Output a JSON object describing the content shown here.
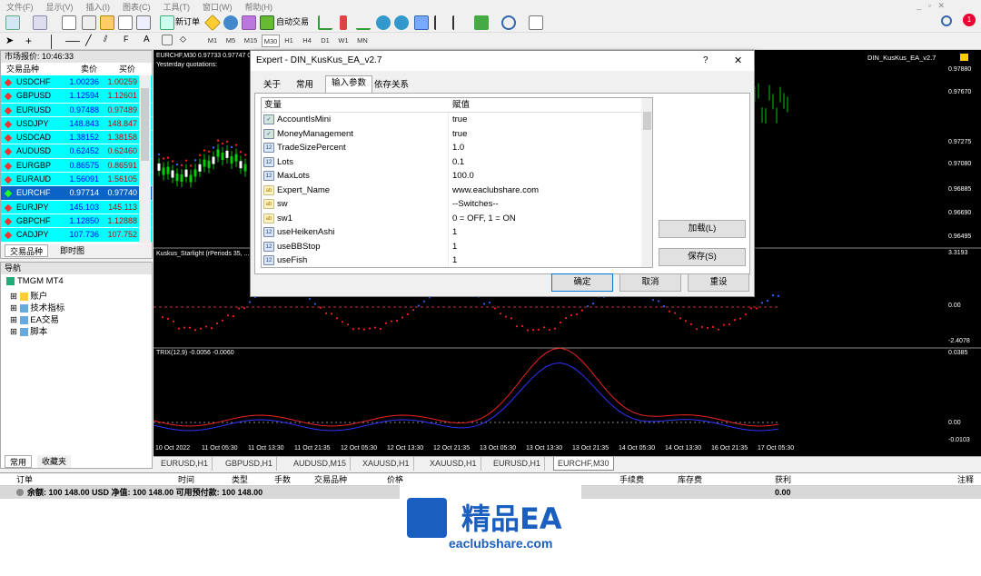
{
  "menu": [
    "文件(F)",
    "显示(V)",
    "插入(I)",
    "图表(C)",
    "工具(T)",
    "窗口(W)",
    "帮助(H)"
  ],
  "toolbar": {
    "new_order": "新订单",
    "auto_trade": "自动交易",
    "notif_count": "1"
  },
  "timeframes": [
    "M1",
    "M5",
    "M15",
    "M30",
    "H1",
    "H4",
    "D1",
    "W1",
    "MN"
  ],
  "market_watch": {
    "title": "市场报价: 10:46:33",
    "col_symbol": "交易品种",
    "col_bid": "卖价",
    "col_ask": "买价",
    "rows": [
      {
        "sym": "USDCHF",
        "bid": "1.00236",
        "ask": "1.00259"
      },
      {
        "sym": "GBPUSD",
        "bid": "1.12594",
        "ask": "1.12601"
      },
      {
        "sym": "EURUSD",
        "bid": "0.97488",
        "ask": "0.97489"
      },
      {
        "sym": "USDJPY",
        "bid": "148.843",
        "ask": "148.847"
      },
      {
        "sym": "USDCAD",
        "bid": "1.38152",
        "ask": "1.38158"
      },
      {
        "sym": "AUDUSD",
        "bid": "0.62452",
        "ask": "0.62460"
      },
      {
        "sym": "EURGBP",
        "bid": "0.86575",
        "ask": "0.86591"
      },
      {
        "sym": "EURAUD",
        "bid": "1.56091",
        "ask": "1.56105"
      },
      {
        "sym": "EURCHF",
        "bid": "0.97714",
        "ask": "0.97740"
      },
      {
        "sym": "EURJPY",
        "bid": "145.103",
        "ask": "145.113"
      },
      {
        "sym": "GBPCHF",
        "bid": "1.12850",
        "ask": "1.12888"
      },
      {
        "sym": "CADJPY",
        "bid": "107.736",
        "ask": "107.752"
      }
    ],
    "tab1": "交易品种",
    "tab2": "即时图"
  },
  "navigator": {
    "title": "导航",
    "root": "TMGM MT4",
    "items": [
      "账户",
      "技术指标",
      "EA交易",
      "脚本"
    ],
    "tab1": "常用",
    "tab2": "收藏夹"
  },
  "chart": {
    "header": "EURCHF,M30  0.97733 0.97747 0.97709 0.97714",
    "quotes": "Yesterday quotations:",
    "ea_label": "DIN_KusKus_EA_v2.7",
    "price_labels": [
      "0.97880",
      "0.97670",
      "0.97275",
      "0.97080",
      "0.96885",
      "0.96690",
      "0.96495"
    ],
    "ind1": "Kuskus_Starlight (rPeriods 35, ...",
    "ind1_levels": [
      "3.3193",
      "0.00",
      "-2.4078"
    ],
    "ind2": "TRIX(12,9) -0.0056 -0.0060",
    "ind2_levels": [
      "0.0385",
      "0.00",
      "-0.0103"
    ],
    "dates": [
      "10 Oct 2022",
      "11 Oct 05:30",
      "11 Oct 13:30",
      "11 Oct 21:35",
      "12 Oct 05:30",
      "12 Oct 13:30",
      "12 Oct 21:35",
      "13 Oct 05:30",
      "13 Oct 13:30",
      "13 Oct 21:35",
      "14 Oct 05:30",
      "14 Oct 13:30",
      "16 Oct 21:35",
      "17 Oct 05:30"
    ]
  },
  "chart_tabs": [
    "EURUSD,H1",
    "GBPUSD,H1",
    "AUDUSD,M15",
    "XAUUSD,H1",
    "XAUUSD,H1",
    "EURUSD,H1",
    "EURCHF,M30"
  ],
  "terminal": {
    "cols": [
      "订单",
      "时间",
      "类型",
      "手数",
      "交易品种",
      "价格",
      "手续费",
      "库存费",
      "获利",
      "注释"
    ],
    "balance": "余额: 100 148.00 USD  净值: 100 148.00  可用预付款: 100 148.00",
    "profit": "0.00"
  },
  "dialog": {
    "title": "Expert - DIN_KusKus_EA_v2.7",
    "help": "?",
    "tabs": [
      "关于",
      "常用",
      "输入参数",
      "依存关系"
    ],
    "col_var": "变量",
    "col_val": "赋值",
    "params": [
      {
        "type": "bool",
        "name": "AccountIsMini",
        "value": "true"
      },
      {
        "type": "bool",
        "name": "MoneyManagement",
        "value": "true"
      },
      {
        "type": "num",
        "name": "TradeSizePercent",
        "value": "1.0"
      },
      {
        "type": "num",
        "name": "Lots",
        "value": "0.1"
      },
      {
        "type": "num",
        "name": "MaxLots",
        "value": "100.0"
      },
      {
        "type": "ab",
        "name": "Expert_Name",
        "value": "www.eaclubshare.com"
      },
      {
        "type": "ab",
        "name": "sw",
        "value": "--Switches--"
      },
      {
        "type": "ab",
        "name": "sw1",
        "value": "0 = OFF, 1 = ON"
      },
      {
        "type": "num",
        "name": "useHeikenAshi",
        "value": "1"
      },
      {
        "type": "num",
        "name": "useBBStop",
        "value": "1"
      },
      {
        "type": "num",
        "name": "useFish",
        "value": "1"
      }
    ],
    "load": "加载(L)",
    "save": "保存(S)",
    "ok": "确定",
    "cancel": "取消",
    "reset": "重设"
  },
  "watermark": {
    "title": "精品EA",
    "url": "eaclubshare.com"
  }
}
